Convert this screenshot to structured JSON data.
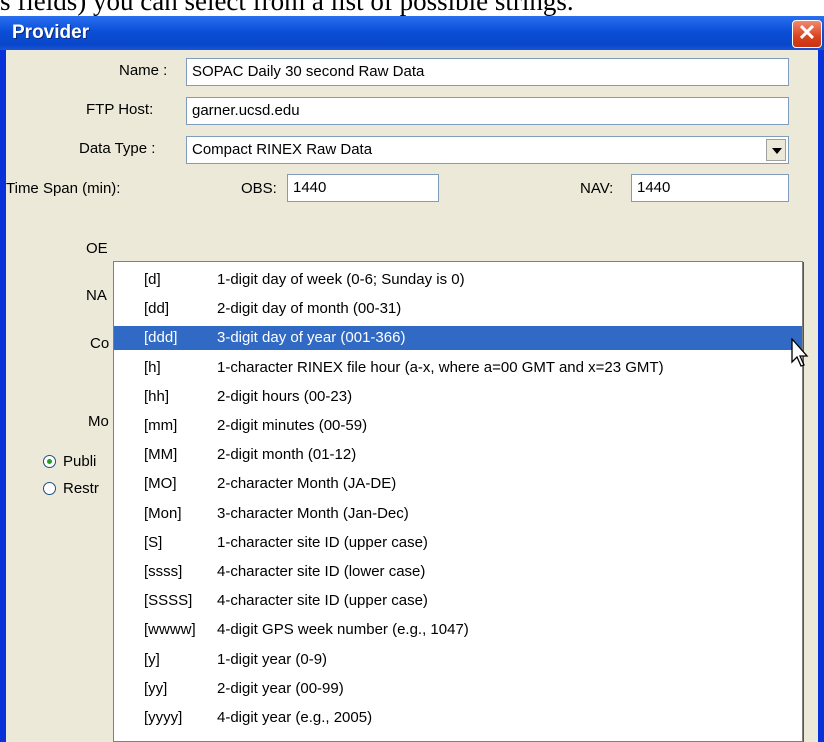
{
  "caption": "s fields) you can select from a list of possible strings.",
  "window": {
    "title": "Provider",
    "close_glyph": "✕"
  },
  "form": {
    "name_label": "Name :",
    "name_value": "SOPAC Daily 30 second Raw Data",
    "ftp_label": "FTP Host:",
    "ftp_value": "garner.ucsd.edu",
    "datatype_label": "Data Type :",
    "datatype_value": "Compact RINEX Raw Data",
    "timespan_label": "Time Span (min):",
    "obs_label": "OBS:",
    "obs_value": "1440",
    "nav_label": "NAV:",
    "nav_value": "1440",
    "partial_labels": [
      "OE",
      "NA",
      "Co",
      "Mo"
    ],
    "radio_public": "Publi",
    "radio_restricted": "Restr"
  },
  "options": [
    {
      "code": "[d]",
      "desc": "1-digit day of week (0-6; Sunday is 0)"
    },
    {
      "code": "[dd]",
      "desc": "2-digit day of month (00-31)"
    },
    {
      "code": "[ddd]",
      "desc": "3-digit day of year (001-366)"
    },
    {
      "code": "[h]",
      "desc": "1-character RINEX file hour (a-x, where a=00 GMT and x=23 GMT)"
    },
    {
      "code": "[hh]",
      "desc": "2-digit hours (00-23)"
    },
    {
      "code": "[mm]",
      "desc": "2-digit minutes (00-59)"
    },
    {
      "code": "[MM]",
      "desc": "2-digit month (01-12)"
    },
    {
      "code": "[MO]",
      "desc": "2-character Month (JA-DE)"
    },
    {
      "code": "[Mon]",
      "desc": "3-character Month (Jan-Dec)"
    },
    {
      "code": "[S]",
      "desc": "1-character site ID (upper case)"
    },
    {
      "code": "[ssss]",
      "desc": "4-character site ID (lower case)"
    },
    {
      "code": "[SSSS]",
      "desc": "4-character site ID (upper case)"
    },
    {
      "code": "[wwww]",
      "desc": "4-digit GPS week number (e.g., 1047)"
    },
    {
      "code": "[y]",
      "desc": "1-digit year (0-9)"
    },
    {
      "code": "[yy]",
      "desc": "2-digit year (00-99)"
    },
    {
      "code": "[yyyy]",
      "desc": "4-digit year (e.g., 2005)"
    }
  ],
  "selected_index": 2,
  "colors": {
    "titlebar": "#0a4fd8",
    "dialog_bg": "#ece9d8",
    "selection": "#316ac5"
  }
}
